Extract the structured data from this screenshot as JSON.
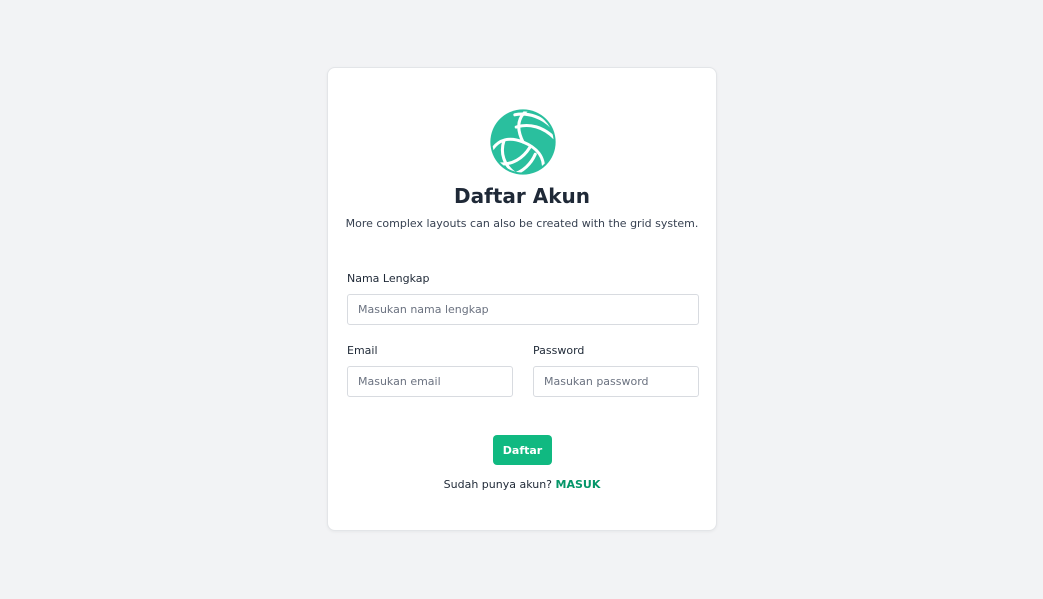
{
  "register": {
    "title": "Daftar Akun",
    "subtitle": "More complex layouts can also be created with the grid system.",
    "logo_icon": "volleyball-icon",
    "accent_color": "#10b981",
    "logo_color": "#2abf9e",
    "fields": {
      "fullname": {
        "label": "Nama Lengkap",
        "placeholder": "Masukan nama lengkap",
        "value": ""
      },
      "email": {
        "label": "Email",
        "placeholder": "Masukan email",
        "value": ""
      },
      "password": {
        "label": "Password",
        "placeholder": "Masukan password",
        "value": ""
      }
    },
    "submit_label": "Daftar",
    "footer_text": "Sudah punya akun?",
    "login_link": "MASUK"
  }
}
